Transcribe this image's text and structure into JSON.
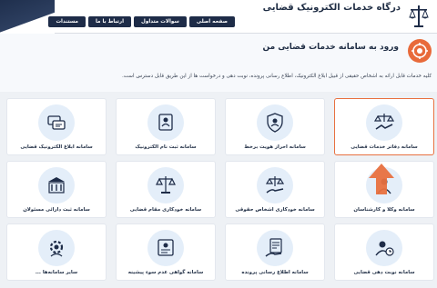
{
  "header": {
    "title": "درگاه خدمات الکترونیک قضایی",
    "nav": [
      "صفحه اصلی",
      "سوالات متداول",
      "ارتباط با ما",
      "مستندات"
    ],
    "emblem_icon": "scales-emblem-icon"
  },
  "intro": {
    "title": "ورود به سامانه خدمات قضایی من",
    "description": "کلیه خدمات قابل ارائه به اشخاص حقیقی از قبیل ابلاغ الکترونیک، اطلاع رسانی پرونده، نوبت دهی و درخواست ها از این طریق قابل دسترس است.",
    "icon": "judicial-logo-icon"
  },
  "services": [
    {
      "label": "سامانه دفاتر خدمات قضایی",
      "icon": "handshake-scales-icon",
      "active": true
    },
    {
      "label": "سامانه احراز هویت برخط",
      "icon": "shield-user-icon",
      "active": false
    },
    {
      "label": "سامانه ثبت نام الکترونیک",
      "icon": "register-icon",
      "active": false
    },
    {
      "label": "سامانه ابلاغ الکترونیک قضایی",
      "icon": "message-icon",
      "active": false
    },
    {
      "label": "سامانه وکلا و کارشناسان",
      "icon": "lawyer-icon",
      "active": false
    },
    {
      "label": "سامانه خودکاری اشخاص حقوقی",
      "icon": "scales-hand-icon",
      "active": false
    },
    {
      "label": "سامانه خودکاری مقام قضایی",
      "icon": "scales-icon",
      "active": false
    },
    {
      "label": "سامانه ثبت دارائی مسئولان",
      "icon": "building-icon",
      "active": false
    },
    {
      "label": "سامانه نوبت دهی قضایی",
      "icon": "user-clock-icon",
      "active": false
    },
    {
      "label": "سامانه اطلاع رسانی پرونده",
      "icon": "document-hand-icon",
      "active": false
    },
    {
      "label": "سامانه گواهی عدم سوء پیشینه",
      "icon": "certificate-icon",
      "active": false
    },
    {
      "label": "سایر سامانه‌ها ...",
      "icon": "gear-user-icon",
      "active": false
    }
  ],
  "colors": {
    "accent": "#e8703f",
    "navy": "#1e2c48",
    "icon_bg": "#e4eef9",
    "page_bg": "#eef1f5"
  }
}
